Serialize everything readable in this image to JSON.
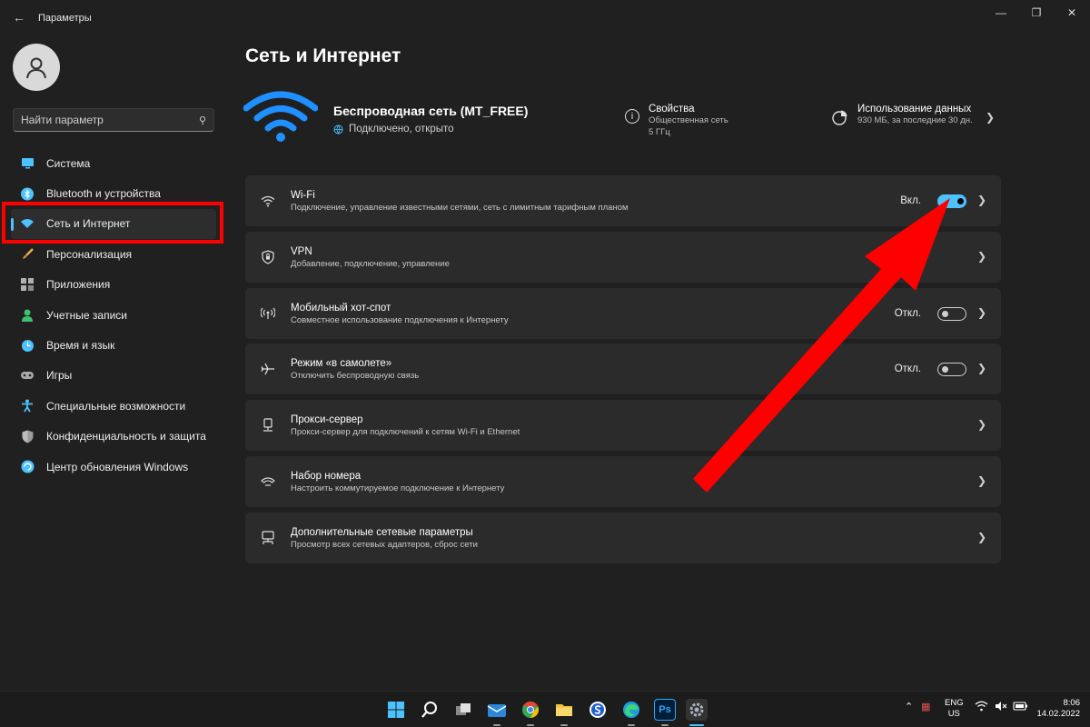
{
  "window": {
    "title": "Параметры",
    "minimize_icon": "minimize-icon",
    "maximize_icon": "restore-icon",
    "close_icon": "close-icon"
  },
  "search": {
    "placeholder": "Найти параметр"
  },
  "sidebar": {
    "items": [
      {
        "label": "Система",
        "icon": "monitor-icon",
        "color": "#4cc2ff"
      },
      {
        "label": "Bluetooth и устройства",
        "icon": "bluetooth-icon",
        "color": "#4cc2ff"
      },
      {
        "label": "Сеть и Интернет",
        "icon": "network-icon",
        "color": "#4cc2ff",
        "active": true
      },
      {
        "label": "Персонализация",
        "icon": "brush-icon",
        "color": "#f2a950"
      },
      {
        "label": "Приложения",
        "icon": "apps-icon",
        "color": "#a0a0a0"
      },
      {
        "label": "Учетные записи",
        "icon": "person-icon",
        "color": "#3fbf6f"
      },
      {
        "label": "Время и язык",
        "icon": "globe-clock-icon",
        "color": "#4cc2ff"
      },
      {
        "label": "Игры",
        "icon": "gamepad-icon",
        "color": "#a0a0a0"
      },
      {
        "label": "Специальные возможности",
        "icon": "accessibility-icon",
        "color": "#4cc2ff"
      },
      {
        "label": "Конфиденциальность и защита",
        "icon": "shield-icon",
        "color": "#a0a0a0"
      },
      {
        "label": "Центр обновления Windows",
        "icon": "update-icon",
        "color": "#4cc2ff"
      }
    ]
  },
  "page": {
    "title": "Сеть и Интернет",
    "network": {
      "name": "Беспроводная сеть (MT_FREE)",
      "status": "Подключено, открыто"
    },
    "properties": {
      "title": "Свойства",
      "line1": "Общественная сеть",
      "line2": "5 ГГц"
    },
    "data_usage": {
      "title": "Использование данных",
      "detail": "930 МБ, за последние 30 дн."
    }
  },
  "cards": [
    {
      "name": "wifi",
      "icon": "wifi-icon",
      "title": "Wi-Fi",
      "subtitle": "Подключение, управление известными сетями, сеть с лимитным тарифным планом",
      "toggle": true,
      "toggle_on": true,
      "toggle_label": "Вкл."
    },
    {
      "name": "vpn",
      "icon": "vpn-shield-icon",
      "title": "VPN",
      "subtitle": "Добавление, подключение, управление",
      "toggle": false
    },
    {
      "name": "hotspot",
      "icon": "hotspot-icon",
      "title": "Мобильный хот-спот",
      "subtitle": "Совместное использование подключения к Интернету",
      "toggle": true,
      "toggle_on": false,
      "toggle_label": "Откл."
    },
    {
      "name": "airplane",
      "icon": "airplane-icon",
      "title": "Режим «в самолете»",
      "subtitle": "Отключить беспроводную связь",
      "toggle": true,
      "toggle_on": false,
      "toggle_label": "Откл."
    },
    {
      "name": "proxy",
      "icon": "proxy-icon",
      "title": "Прокси-сервер",
      "subtitle": "Прокси-сервер для подключений к сетям Wi-Fi и Ethernet",
      "toggle": false
    },
    {
      "name": "dialup",
      "icon": "dialup-icon",
      "title": "Набор номера",
      "subtitle": "Настроить коммутируемое подключение к Интернету",
      "toggle": false
    },
    {
      "name": "advanced",
      "icon": "network-adapter-icon",
      "title": "Дополнительные сетевые параметры",
      "subtitle": "Просмотр всех сетевых адаптеров, сброс сети",
      "toggle": false
    }
  ],
  "taskbar": {
    "apps": [
      {
        "name": "start-icon",
        "color": "#4cc2ff"
      },
      {
        "name": "search-icon",
        "color": "#ffffff"
      },
      {
        "name": "task-view-icon",
        "color": "#d0d0d0"
      },
      {
        "name": "mail-icon",
        "color": "#2b88d8"
      },
      {
        "name": "chrome-icon",
        "color": "#34a853"
      },
      {
        "name": "file-explorer-icon",
        "color": "#f4c542"
      },
      {
        "name": "app-s-icon",
        "color": "#1e90ff"
      },
      {
        "name": "edge-icon",
        "color": "#2fb4a7"
      },
      {
        "name": "photoshop-icon",
        "color": "#31a8ff",
        "label": "Ps"
      },
      {
        "name": "settings-icon",
        "color": "#9aa0a6"
      }
    ],
    "lang_top": "ENG",
    "lang_bottom": "US",
    "time": "8:06",
    "date": "14.02.2022"
  }
}
